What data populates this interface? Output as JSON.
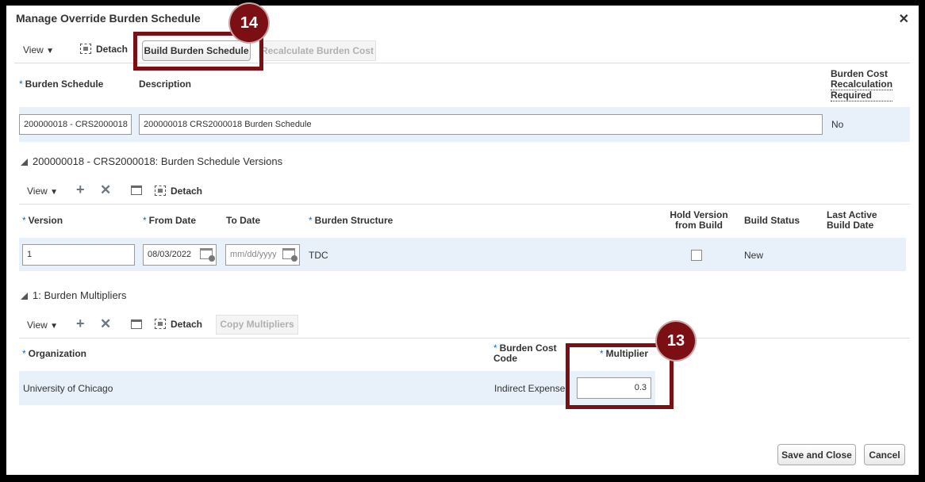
{
  "dialog": {
    "title": "Manage Override Burden Schedule"
  },
  "toolbar": {
    "view_label": "View",
    "detach_label": "Detach",
    "build_label": "Build Burden Schedule",
    "recalc_label": "Recalculate Burden Cost"
  },
  "schedule_table": {
    "headers": {
      "schedule": "Burden Schedule",
      "description": "Description",
      "recalc_line1": "Burden Cost",
      "recalc_line2": "Recalculation",
      "recalc_line3": "Required"
    },
    "row": {
      "schedule": "200000018 - CRS2000018",
      "description": "200000018 CRS2000018 Burden Schedule",
      "recalc": "No"
    }
  },
  "versions_section": {
    "title": "200000018 - CRS2000018: Burden Schedule Versions",
    "toolbar": {
      "view_label": "View",
      "detach_label": "Detach"
    },
    "headers": {
      "version": "Version",
      "from_date": "From Date",
      "to_date": "To Date",
      "structure": "Burden Structure",
      "hold_line1": "Hold Version",
      "hold_line2": "from Build",
      "build_status": "Build Status",
      "last_active_line1": "Last Active",
      "last_active_line2": "Build Date"
    },
    "row": {
      "version": "1",
      "from_date": "08/03/2022",
      "to_date_placeholder": "mm/dd/yyyy",
      "structure": "TDC",
      "build_status": "New"
    }
  },
  "multipliers_section": {
    "title": "1: Burden Multipliers",
    "toolbar": {
      "view_label": "View",
      "detach_label": "Detach",
      "copy_label": "Copy Multipliers"
    },
    "headers": {
      "organization": "Organization",
      "cost_code_line1": "Burden Cost",
      "cost_code_line2": "Code",
      "multiplier": "Multiplier"
    },
    "row": {
      "organization": "University of Chicago",
      "cost_code": "Indirect Expense",
      "multiplier": "0.3"
    }
  },
  "footer": {
    "save_close_label": "Save and Close",
    "cancel_label": "Cancel"
  },
  "callouts": {
    "build_step": "14",
    "multiplier_step": "13"
  },
  "colors": {
    "callout": "#7b0f13",
    "row_highlight": "#e8f1f9",
    "required_asterisk": "#0572ce"
  }
}
